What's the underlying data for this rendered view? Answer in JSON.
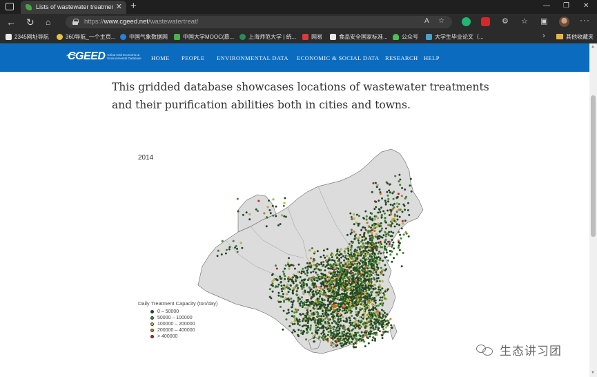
{
  "browser": {
    "tab_title": "Lists of wastewater treatment in c",
    "tab_close": "✕",
    "new_tab": "+",
    "url_host": "https://www.cgeed.net",
    "url_path": "/wastewatertreat/",
    "url_prefix": "https://",
    "url_domain": "www.cgeed.net"
  },
  "bookmarks": [
    {
      "label": "2345网址导航",
      "color": "#3a7bd5"
    },
    {
      "label": "360导航_一个主页...",
      "color": "#e8c23a"
    },
    {
      "label": "中国气象数据网",
      "color": "#2a7fd8"
    },
    {
      "label": "中国大学MOOC(慕...",
      "color": "#4bb04b"
    },
    {
      "label": "上海师范大学 | 统...",
      "color": "#2e8b57"
    },
    {
      "label": "网易",
      "color": "#d93a3a"
    },
    {
      "label": "食品安全国家标准...",
      "color": "#d9d9d9"
    },
    {
      "label": "公众号",
      "color": "#4fc04f"
    },
    {
      "label": "大学生毕业论文（...",
      "color": "#4aa0c9"
    }
  ],
  "bookmarks_folder": "其他收藏夹",
  "site": {
    "logo_text": "CGEED",
    "logo_sub": "China Grid Economic & Environmental Database",
    "nav": [
      "HOME",
      "PEOPLE",
      "ENVIRONMENTAL DATA",
      "ECONOMIC & SOCIAL DATA",
      "RESEARCH",
      "HELP"
    ]
  },
  "intro_text": "This gridded database showcases locations of wastewater treatments and their purification abilities both in cities and towns.",
  "map": {
    "year": "2014",
    "legend_title": "Daily Treatment Capacity (ton/day)",
    "legend": [
      {
        "label": "0 – 50000",
        "color": "#1e4d1e"
      },
      {
        "label": "50000 – 100000",
        "color": "#3f8f2a"
      },
      {
        "label": "100000 – 200000",
        "color": "#c7c23a"
      },
      {
        "label": "200000 – 400000",
        "color": "#e07a1f"
      },
      {
        "label": "> 400000",
        "color": "#c0211f"
      }
    ]
  },
  "watermark": "生态讲习团"
}
